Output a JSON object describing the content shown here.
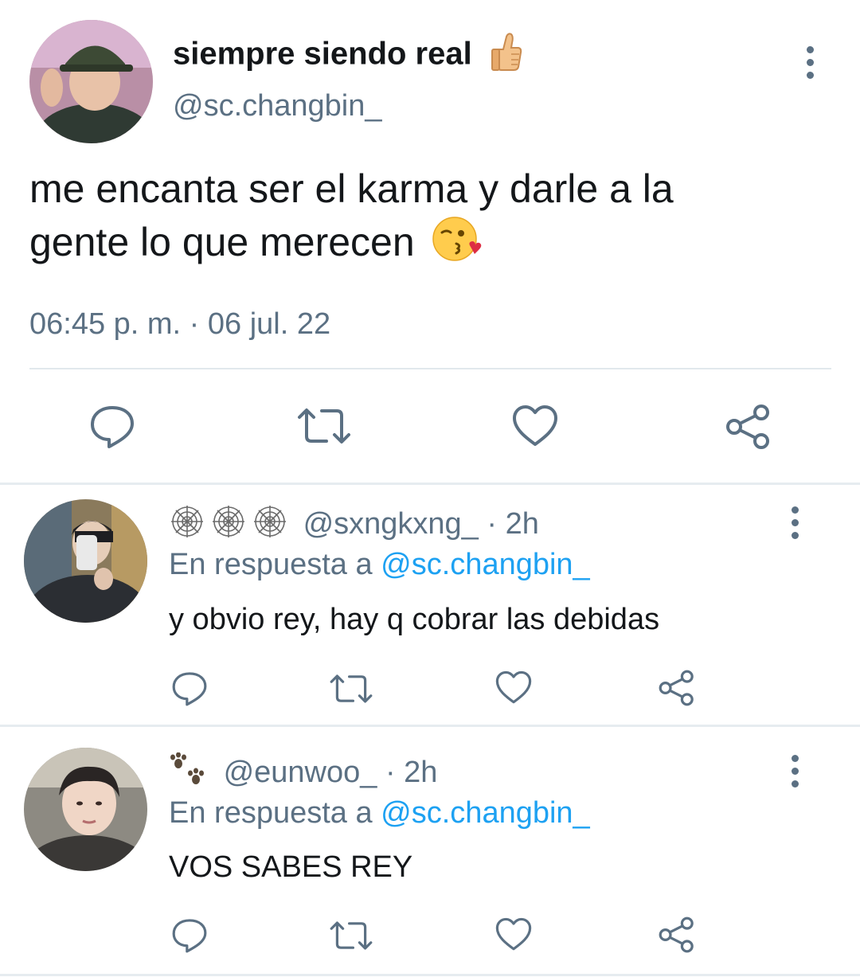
{
  "main_tweet": {
    "display_name": "siempre siendo real",
    "handle": "@sc.changbin_",
    "text_line1": "me encanta ser el karma y darle a la",
    "text_line2": "gente lo que merecen",
    "timestamp": "06:45 p. m. · 06 jul. 22"
  },
  "replies": [
    {
      "prefix_icons": [
        "spider-web-icon",
        "spider-web-icon",
        "spider-web-icon"
      ],
      "handle": "@sxngkxng_",
      "time": "· 2h",
      "reply_prefix": "En respuesta a ",
      "reply_to": "@sc.changbin_",
      "text": "y obvio rey, hay q cobrar las debidas"
    },
    {
      "prefix_icons": [
        "paw-prints-icon"
      ],
      "handle": "@eunwoo_",
      "time": "· 2h",
      "reply_prefix": "En respuesta a ",
      "reply_to": "@sc.changbin_",
      "text": "VOS SABES REY"
    }
  ],
  "icons": [
    "comment-icon",
    "retweet-icon",
    "like-icon",
    "share-icon",
    "more-options-icon",
    "thumbs-up-icon",
    "kiss-face-icon"
  ],
  "colors": {
    "text": "#14171a",
    "secondary": "#5b7083",
    "link": "#1da1f2",
    "divider": "#e1e8ed"
  }
}
